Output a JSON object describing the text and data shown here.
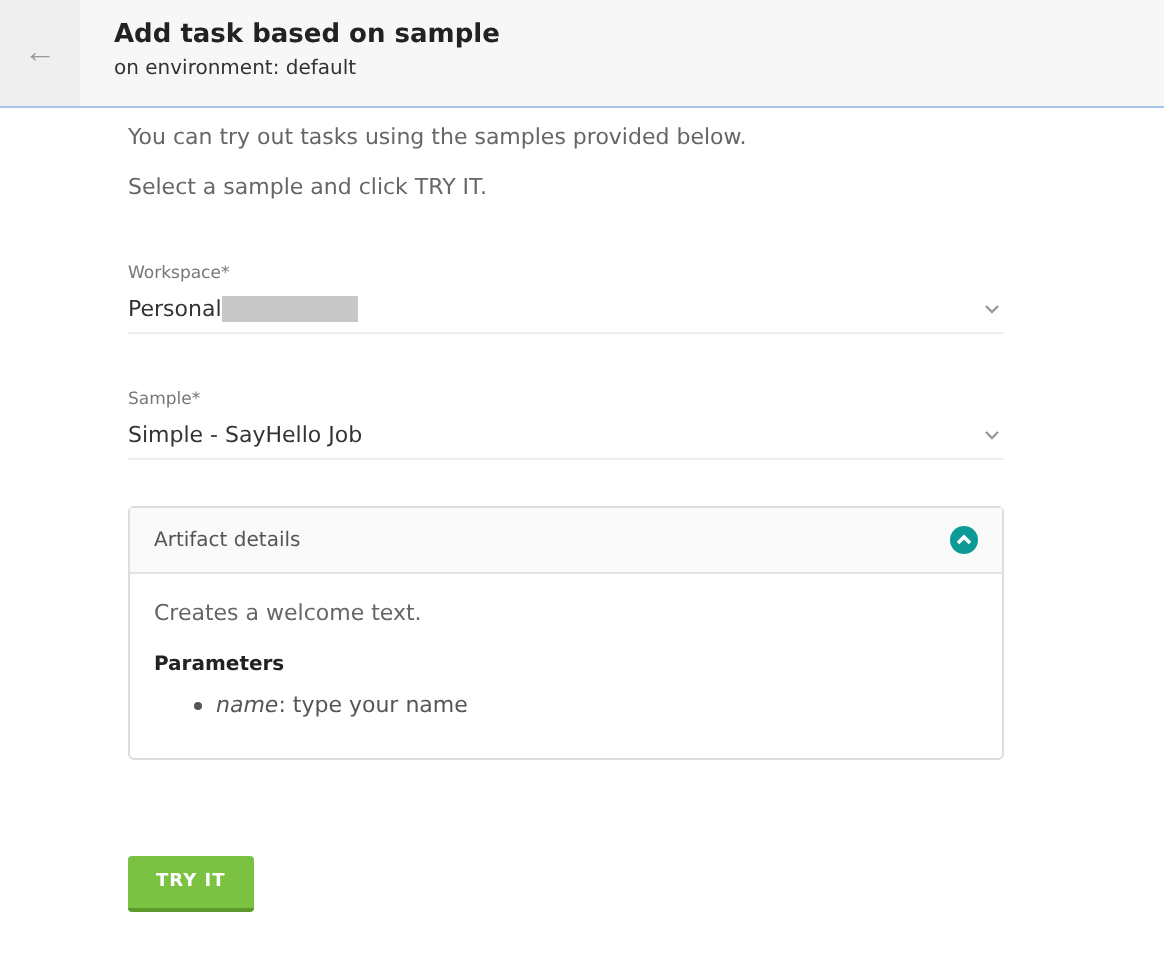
{
  "header": {
    "back_icon": "←",
    "title": "Add task based on sample",
    "subtitle": "on environment: default"
  },
  "intro": [
    "You can try out tasks using the samples provided below.",
    "Select a sample and click TRY IT."
  ],
  "fields": [
    {
      "label": "Workspace*",
      "value": "Personal",
      "redacted": true
    },
    {
      "label": "Sample*",
      "value": "Simple - SayHello Job",
      "redacted": false
    }
  ],
  "artifact": {
    "title": "Artifact details",
    "expanded": true,
    "description": "Creates a welcome text.",
    "parameters_heading": "Parameters",
    "parameters": [
      "*name*: type your name"
    ]
  },
  "button": "TRY IT"
}
